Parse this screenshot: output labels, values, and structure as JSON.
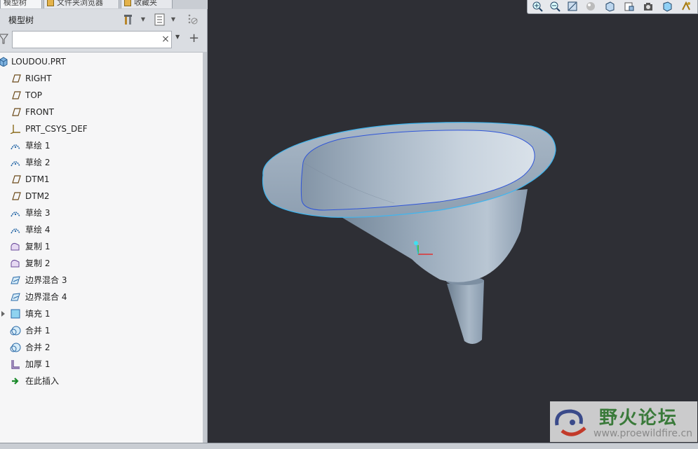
{
  "tabs": [
    {
      "label": "模型树"
    },
    {
      "label": "文件夹浏览器"
    },
    {
      "label": "收藏夹"
    }
  ],
  "tree_header": {
    "title": "模型树"
  },
  "filter": {
    "value": "",
    "placeholder": ""
  },
  "tree": {
    "root": {
      "label": "LOUDOU.PRT",
      "icon": "part-icon"
    },
    "items": [
      {
        "label": "RIGHT",
        "icon": "datum-plane-icon"
      },
      {
        "label": "TOP",
        "icon": "datum-plane-icon"
      },
      {
        "label": "FRONT",
        "icon": "datum-plane-icon"
      },
      {
        "label": "PRT_CSYS_DEF",
        "icon": "coordinate-system-icon"
      },
      {
        "label": "草绘 1",
        "icon": "sketch-icon"
      },
      {
        "label": "草绘 2",
        "icon": "sketch-icon"
      },
      {
        "label": "DTM1",
        "icon": "datum-plane-icon"
      },
      {
        "label": "DTM2",
        "icon": "datum-plane-icon"
      },
      {
        "label": "草绘 3",
        "icon": "sketch-icon"
      },
      {
        "label": "草绘 4",
        "icon": "sketch-icon"
      },
      {
        "label": "复制 1",
        "icon": "copy-surface-icon"
      },
      {
        "label": "复制 2",
        "icon": "copy-surface-icon"
      },
      {
        "label": "边界混合 3",
        "icon": "boundary-blend-icon"
      },
      {
        "label": "边界混合 4",
        "icon": "boundary-blend-icon"
      },
      {
        "label": "填充 1",
        "icon": "fill-icon"
      },
      {
        "label": "合并 1",
        "icon": "merge-icon"
      },
      {
        "label": "合并 2",
        "icon": "merge-icon"
      },
      {
        "label": "加厚 1",
        "icon": "thicken-icon"
      },
      {
        "label": "在此插入",
        "icon": "insert-here-icon"
      }
    ]
  },
  "watermark": {
    "text": "野火论坛",
    "url": "www.proewildfire.cn"
  },
  "colors": {
    "viewport": "#2e2f35",
    "panel": "#dadde2",
    "model": "#8fa2b6",
    "highlight": "#3fb6f0"
  }
}
